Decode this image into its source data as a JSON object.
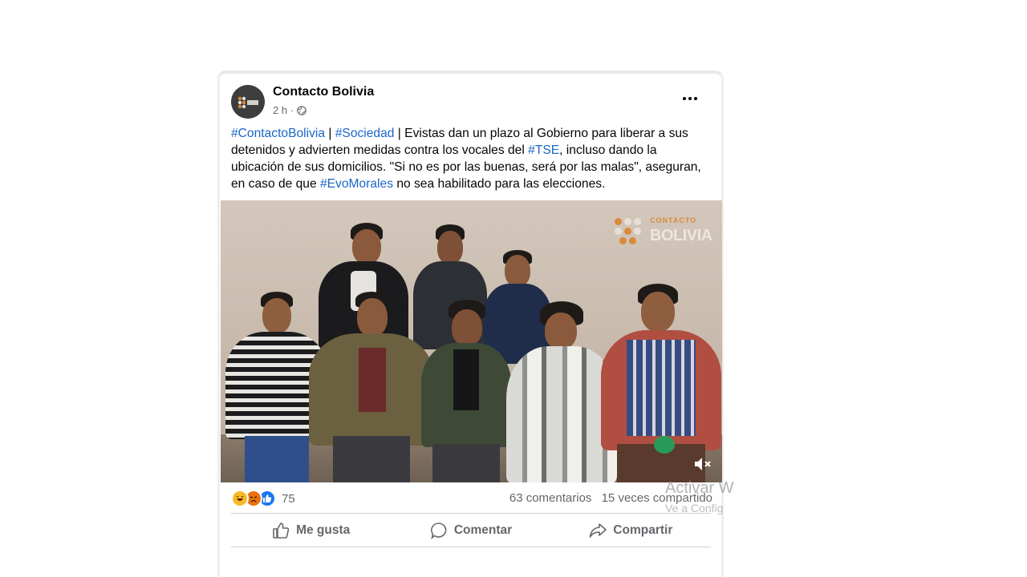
{
  "post": {
    "page_name": "Contacto Bolivia",
    "time": "2 h ·",
    "visibility_icon": "globe-icon",
    "text_segments": [
      {
        "text": "#ContactoBolivia",
        "link": true
      },
      {
        "text": " | ",
        "link": false
      },
      {
        "text": "#Sociedad",
        "link": true
      },
      {
        "text": " | Evistas dan un plazo al Gobierno para liberar a sus detenidos y advierten medidas contra los vocales del ",
        "link": false
      },
      {
        "text": "#TSE",
        "link": true
      },
      {
        "text": ", incluso dando la ubicación de sus domicilios. \"Si no es por las buenas, será por las malas\", aseguran, en caso de que ",
        "link": false
      },
      {
        "text": "#EvoMorales",
        "link": true
      },
      {
        "text": " no sea habilitado para las elecciones.",
        "link": false
      }
    ]
  },
  "video": {
    "watermark_top": "CONTACTO",
    "watermark": "BOLIVIA",
    "mute_icon": "muted-speaker-icon"
  },
  "stats": {
    "reaction_icons": [
      "haha-icon",
      "angry-icon",
      "like-icon"
    ],
    "reaction_count": "75",
    "comments": "63 comentarios",
    "shares": "15 veces compartido"
  },
  "actions": {
    "like": "Me gusta",
    "comment": "Comentar",
    "share": "Compartir"
  },
  "os_overlay": {
    "title": "Activar W",
    "subtitle": "Ve a Config"
  },
  "colors": {
    "link": "#1b66c9",
    "secondary_text": "#65676b",
    "like_blue": "#1877f2",
    "angry_orange": "#e9710f",
    "haha_yellow": "#f7b928"
  }
}
